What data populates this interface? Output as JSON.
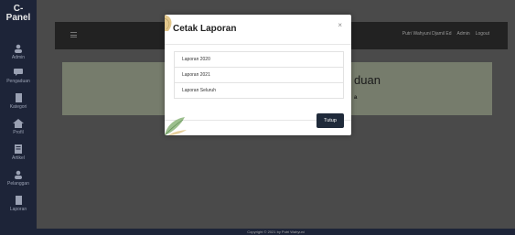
{
  "sidebar": {
    "brand": "C-\nPanel",
    "items": [
      {
        "label": "Admin",
        "icon": "user-icon"
      },
      {
        "label": "Pengaduan",
        "icon": "chat-icon"
      },
      {
        "label": "Kategori",
        "icon": "file-icon"
      },
      {
        "label": "Profil",
        "icon": "home-icon"
      },
      {
        "label": "Artikel",
        "icon": "document-icon"
      },
      {
        "label": "Pelanggan",
        "icon": "user-icon"
      },
      {
        "label": "Laporan",
        "icon": "file-icon"
      }
    ]
  },
  "topbar": {
    "nav": [
      "Putri Wahyuni Djamil Ed",
      "Admin",
      "Logout"
    ]
  },
  "background": {
    "heading": "duan",
    "sub": "a"
  },
  "footer": {
    "text": "Copyright © 2021 by Putri Wahyuni"
  },
  "modal": {
    "title": "Cetak Laporan",
    "close": "×",
    "items": [
      "Laporan 2020",
      "Laporan 2021",
      "Laporan Seluruh"
    ],
    "button": "Tutup"
  },
  "colors": {
    "sidebar": "#1d2438",
    "overlay": "#4a4a4a",
    "button": "#1f2a3a"
  }
}
